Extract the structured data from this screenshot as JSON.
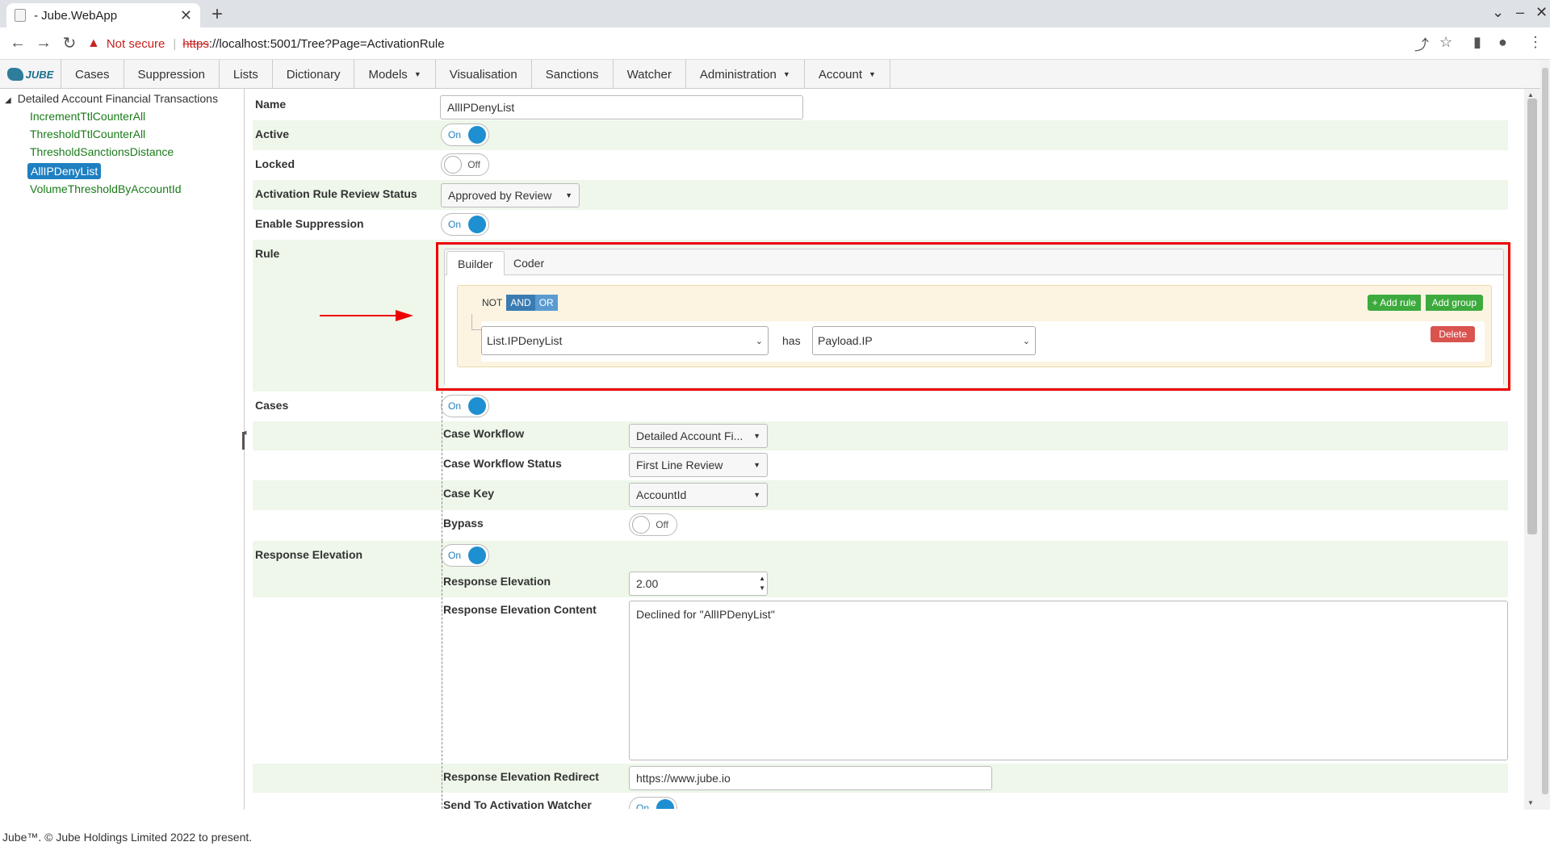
{
  "browser": {
    "tab_title": "- Jube.WebApp",
    "not_secure": "Not secure",
    "url_scheme": "https",
    "url_rest": "://localhost:5001/Tree?Page=ActivationRule"
  },
  "nav": {
    "items": [
      {
        "label": "Cases",
        "dropdown": false
      },
      {
        "label": "Suppression",
        "dropdown": false
      },
      {
        "label": "Lists",
        "dropdown": false
      },
      {
        "label": "Dictionary",
        "dropdown": false
      },
      {
        "label": "Models",
        "dropdown": true
      },
      {
        "label": "Visualisation",
        "dropdown": false
      },
      {
        "label": "Sanctions",
        "dropdown": false
      },
      {
        "label": "Watcher",
        "dropdown": false
      },
      {
        "label": "Administration",
        "dropdown": true
      },
      {
        "label": "Account",
        "dropdown": true
      }
    ]
  },
  "tree": {
    "root": "Detailed Account Financial Transactions",
    "items": [
      "IncrementTtlCounterAll",
      "ThresholdTtlCounterAll",
      "ThresholdSanctionsDistance",
      "AllIPDenyList",
      "VolumeThresholdByAccountId"
    ],
    "selected_index": 3
  },
  "form": {
    "name_label": "Name",
    "name_value": "AllIPDenyList",
    "active_label": "Active",
    "locked_label": "Locked",
    "review_status_label": "Activation Rule Review Status",
    "review_status_value": "Approved by Review",
    "enable_suppression_label": "Enable Suppression",
    "rule_label": "Rule",
    "cases_label": "Cases",
    "case_workflow_label": "Case Workflow",
    "case_workflow_value": "Detailed Account Fi...",
    "case_workflow_status_label": "Case Workflow Status",
    "case_workflow_status_value": "First Line Review",
    "case_key_label": "Case Key",
    "case_key_value": "AccountId",
    "bypass_label": "Bypass",
    "response_elevation_label": "Response Elevation",
    "response_elevation_sub_label": "Response Elevation",
    "response_elevation_value": "2.00",
    "response_elevation_content_label": "Response Elevation Content",
    "response_elevation_content_value": "Declined for \"AllIPDenyList\"",
    "response_elevation_redirect_label": "Response Elevation Redirect",
    "response_elevation_redirect_value": "https://www.jube.io",
    "send_to_watcher_label": "Send To Activation Watcher"
  },
  "switch": {
    "on": "On",
    "off": "Off"
  },
  "rule_builder": {
    "tab_builder": "Builder",
    "tab_coder": "Coder",
    "not": "NOT",
    "and": "AND",
    "or": "OR",
    "add_rule": "+ Add rule",
    "add_group": "Add group",
    "field": "List.IPDenyList",
    "operator": "has",
    "value": "Payload.IP",
    "delete": "Delete"
  },
  "footer": {
    "text": "Jube™. © Jube Holdings Limited 2022 to present."
  },
  "colors": {
    "accent": "#1e7fc1",
    "tree_link": "#1a7a1a",
    "highlight": "#e00000",
    "row_alt": "#eef7ea"
  }
}
